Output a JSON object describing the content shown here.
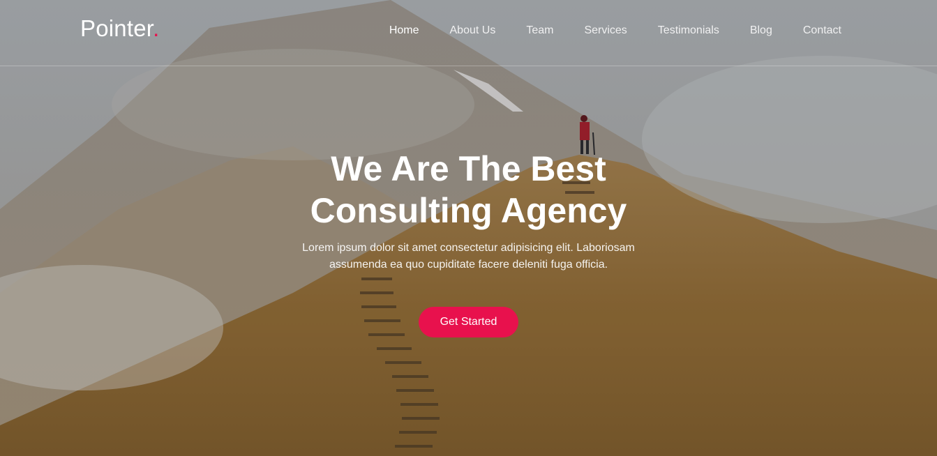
{
  "brand": {
    "name": "Pointer",
    "dot": ".",
    "accent_color": "#e8114d"
  },
  "nav": {
    "items": [
      {
        "label": "Home",
        "active": true
      },
      {
        "label": "About Us"
      },
      {
        "label": "Team"
      },
      {
        "label": "Services"
      },
      {
        "label": "Testimonials"
      },
      {
        "label": "Blog"
      },
      {
        "label": "Contact"
      }
    ]
  },
  "hero": {
    "title_line1": "We Are The Best",
    "title_line2": "Consulting Agency",
    "subtitle": "Lorem ipsum dolor sit amet consectetur adipisicing elit. Laboriosam assumenda ea quo cupiditate facere deleniti fuga officia.",
    "cta_label": "Get Started",
    "background_image": "foggy-mountain-staircase"
  }
}
